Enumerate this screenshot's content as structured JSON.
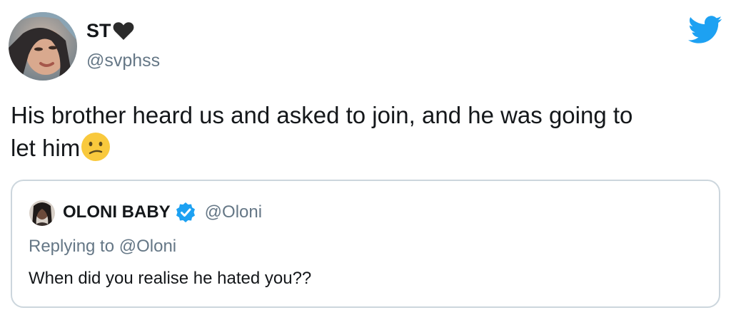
{
  "author": {
    "display_name": "ST",
    "handle": "@svphss",
    "avatar_icon": "profile-photo"
  },
  "brand_icon": "twitter-bird-icon",
  "colors": {
    "text": "#14171a",
    "muted": "#657786",
    "brand": "#1da1f2",
    "border": "#ccd6dd"
  },
  "tweet": {
    "line1": "His brother heard us and asked to join, and he was going to",
    "line2": "let him",
    "emoji": "confused-face"
  },
  "quoted": {
    "display_name": "OLONI BABY",
    "verified": true,
    "handle": "@Oloni",
    "replying_to": "Replying to @Oloni",
    "text": "When did you realise he hated you??"
  }
}
